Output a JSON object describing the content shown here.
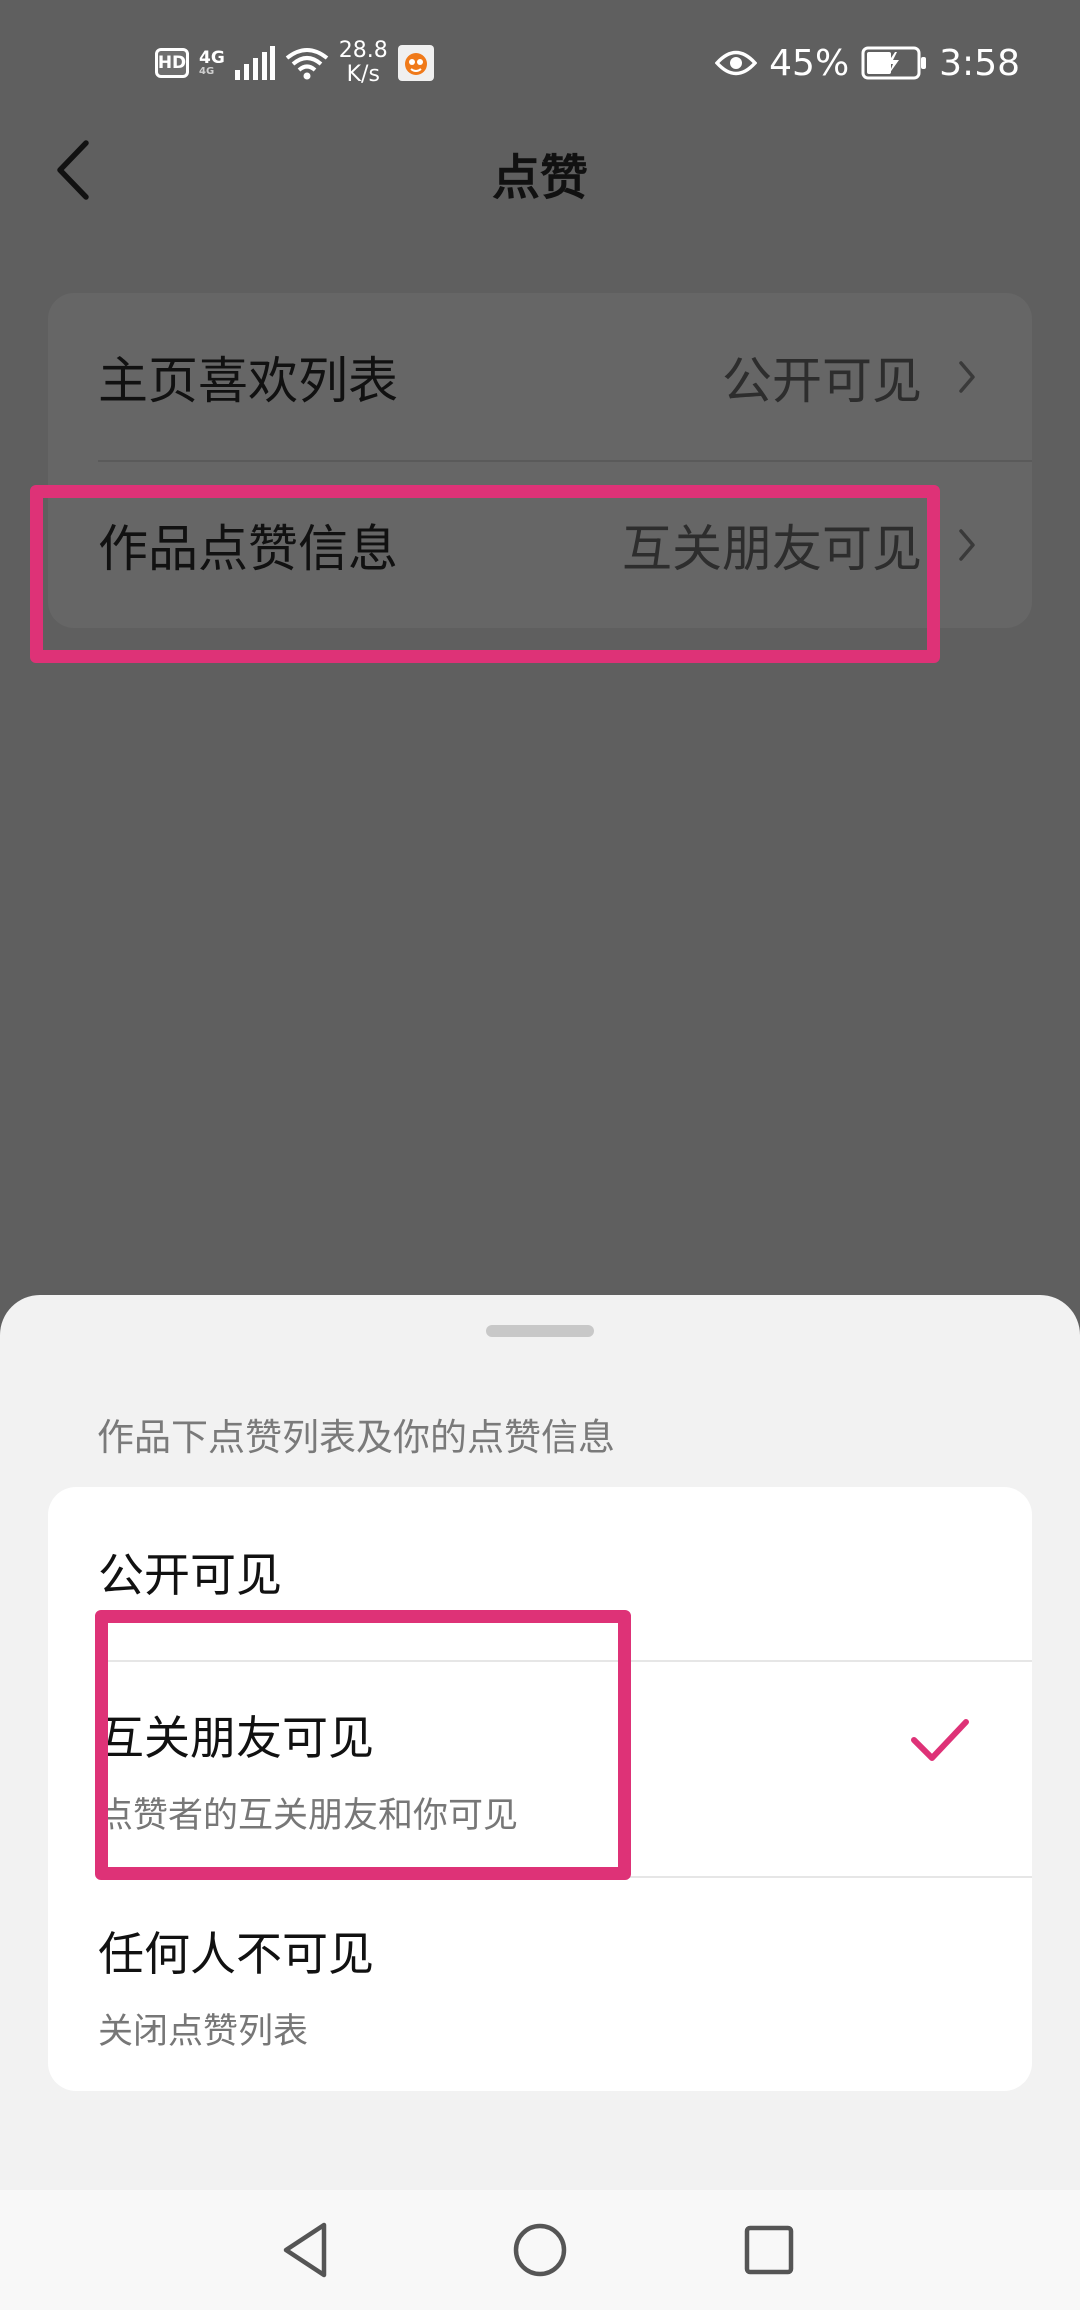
{
  "status_bar": {
    "hd": "HD",
    "network_type": "4G",
    "network_sub": "4G",
    "speed_value": "28.8",
    "speed_unit": "K/s",
    "battery_percent": "45%",
    "time": "3:58",
    "icons": [
      "signal-icon",
      "wifi-icon",
      "app-notification-icon",
      "eye-icon",
      "battery-charging-icon"
    ]
  },
  "header": {
    "title": "点赞"
  },
  "settings": [
    {
      "label": "主页喜欢列表",
      "value": "公开可见"
    },
    {
      "label": "作品点赞信息",
      "value": "互关朋友可见"
    }
  ],
  "sheet": {
    "description": "作品下点赞列表及你的点赞信息",
    "options": [
      {
        "title": "公开可见",
        "subtitle": "",
        "selected": false
      },
      {
        "title": "互关朋友可见",
        "subtitle": "点赞者的互关朋友和你可见",
        "selected": true
      },
      {
        "title": "任何人不可见",
        "subtitle": "关闭点赞列表",
        "selected": false
      }
    ]
  },
  "colors": {
    "accent": "#de3277",
    "highlight_box": "#de3277",
    "overlay": "#5f5f5f"
  },
  "nav": {
    "buttons": [
      "back-triangle-icon",
      "home-circle-icon",
      "recents-square-icon"
    ]
  }
}
